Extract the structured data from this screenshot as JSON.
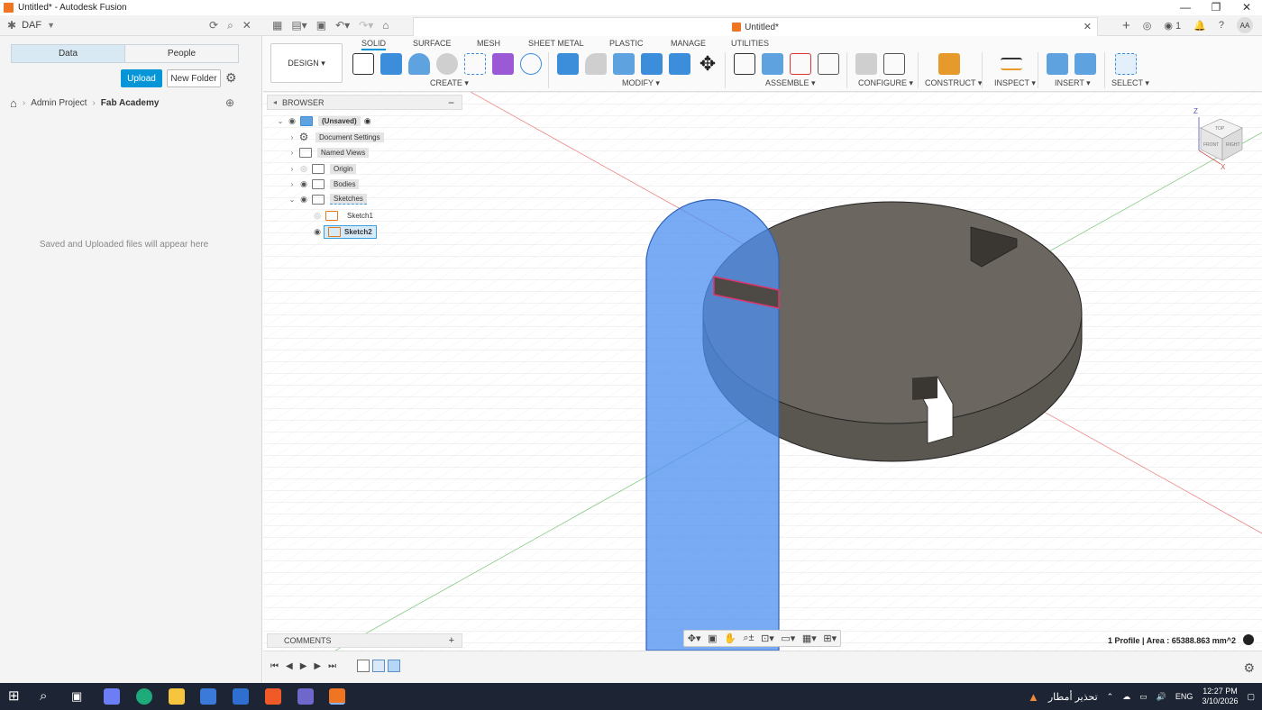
{
  "window": {
    "title": "Untitled* - Autodesk Fusion",
    "controls": [
      "—",
      "❐",
      "✕"
    ]
  },
  "header": {
    "team_name": "DAF",
    "doc_tab_title": "Untitled*",
    "notification_count": "1",
    "avatar_initials": "AA"
  },
  "data_panel": {
    "tabs": [
      "Data",
      "People"
    ],
    "upload_label": "Upload",
    "new_folder_label": "New Folder",
    "breadcrumb": [
      "Admin Project",
      "Fab Academy"
    ],
    "empty_message": "Saved and Uploaded files will appear here"
  },
  "toolbar": {
    "workspace_label": "DESIGN",
    "tabs": [
      "SOLID",
      "SURFACE",
      "MESH",
      "SHEET METAL",
      "PLASTIC",
      "MANAGE",
      "UTILITIES"
    ],
    "groups": [
      "CREATE ▾",
      "MODIFY ▾",
      "ASSEMBLE ▾",
      "CONFIGURE ▾",
      "CONSTRUCT ▾",
      "INSPECT ▾",
      "INSERT ▾",
      "SELECT ▾"
    ]
  },
  "browser": {
    "title": "BROWSER",
    "items": [
      {
        "label": "(Unsaved)"
      },
      {
        "label": "Document Settings"
      },
      {
        "label": "Named Views"
      },
      {
        "label": "Origin"
      },
      {
        "label": "Bodies"
      },
      {
        "label": "Sketches"
      },
      {
        "label": "Sketch1"
      },
      {
        "label": "Sketch2"
      }
    ]
  },
  "comments": {
    "title": "COMMENTS"
  },
  "status": {
    "text": "1 Profile | Area : 65388.863 mm^2"
  },
  "viewcube": {
    "top_label": "TOP",
    "front_label": "FRONT",
    "right_label": "RIGHT",
    "z_label": "Z",
    "x_label": "X"
  },
  "taskbar": {
    "weather_text": "تحذير أمطار",
    "language": "ENG",
    "time": "12:27 PM",
    "date": "3/10/2026"
  },
  "colors": {
    "accent": "#0696d7",
    "sketch_blue": "#4b8ff0",
    "body_gray": "#6b665f",
    "taskbar": "#1d2433"
  }
}
